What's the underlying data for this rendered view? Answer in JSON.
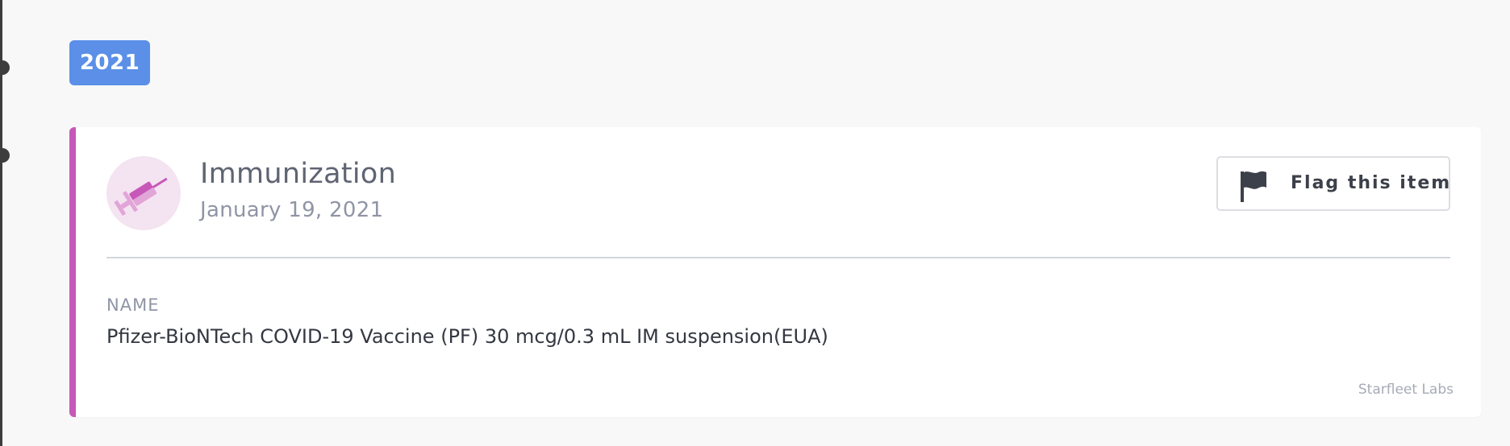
{
  "timeline": {
    "year": "2021"
  },
  "card": {
    "accent_color": "#c758b8",
    "icon": "syringe-icon",
    "title": "Immunization",
    "date": "January 19, 2021",
    "flag_button": {
      "label": "Flag this item",
      "icon": "flag-icon"
    },
    "fields": [
      {
        "label": "NAME",
        "value": "Pfizer-BioNTech COVID-19 Vaccine (PF) 30 mcg/0.3 mL IM suspension(EUA)"
      }
    ],
    "source": "Starfleet Labs"
  }
}
